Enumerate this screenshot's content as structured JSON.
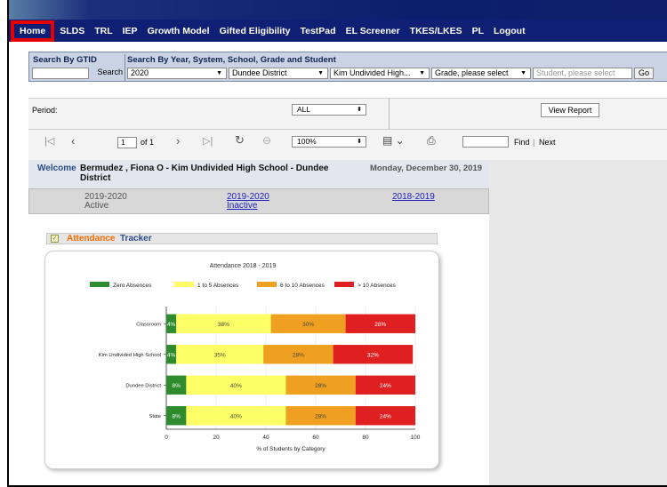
{
  "nav": {
    "items": [
      "Home",
      "SLDS",
      "TRL",
      "IEP",
      "Growth Model",
      "Gifted Eligibility",
      "TestPad",
      "EL Screener",
      "TKES/LKES",
      "PL",
      "Logout"
    ]
  },
  "search": {
    "gtid_label": "Search By GTID",
    "gtid_value": "",
    "search_button": "Search",
    "year_label": "Search By Year, System, School, Grade and Student",
    "year": "2020",
    "system": "Dundee District",
    "school": "Kim Undivided High...",
    "grade": "Grade, please select",
    "student_placeholder": "Student, please select",
    "go_button": "Go"
  },
  "params": {
    "period_label": "Period:",
    "period_value": "ALL",
    "view_report": "View Report"
  },
  "report_toolbar": {
    "page_value": "1",
    "of_pages": "of 1",
    "zoom": "100%",
    "find_label": "Find",
    "separator": "|",
    "next_label": "Next"
  },
  "welcome": {
    "label": "Welcome",
    "name": "Bermudez , Fiona O - Kim Undivided High School - Dundee District",
    "date": "Monday, December 30, 2019"
  },
  "years": {
    "active_year": "2019-2020",
    "active_label": "Active",
    "inactive_year": "2019-2020",
    "inactive_label": "Inactive",
    "other_year": "2018-2019"
  },
  "tracker": {
    "title_part1": "Attendance",
    "title_part2": "Tracker"
  },
  "colors": {
    "zero": "#2e8b2e",
    "one_to_five": "#ffff66",
    "six_to_ten": "#f0a020",
    "over_ten": "#e02020",
    "nav_bg": "#0f1f73",
    "highlight": "#e60000"
  },
  "chart_data": {
    "type": "bar",
    "orientation": "horizontal",
    "stacked": true,
    "title": "Attendance 2018 - 2019",
    "xlabel": "% of Students by Category",
    "ylabel": "",
    "xlim": [
      0,
      100
    ],
    "xticks": [
      "0",
      "20",
      "40",
      "60",
      "80",
      "100"
    ],
    "categories": [
      "Classroom",
      "Kim Undivided High School",
      "Dundee District",
      "State"
    ],
    "legend_position": "top",
    "series": [
      {
        "name": "Zero Absences",
        "values": [
          4,
          4,
          8,
          8
        ],
        "labels": [
          "4%",
          "4%",
          "8%",
          "8%"
        ]
      },
      {
        "name": "1 to 5 Absences",
        "values": [
          38,
          35,
          40,
          40
        ],
        "labels": [
          "38%",
          "35%",
          "40%",
          "40%"
        ]
      },
      {
        "name": "6 to 10 Absences",
        "values": [
          30,
          28,
          28,
          28
        ],
        "labels": [
          "30%",
          "28%",
          "28%",
          "28%"
        ]
      },
      {
        "name": "> 10 Absences",
        "values": [
          28,
          32,
          24,
          24
        ],
        "labels": [
          "28%",
          "32%",
          "24%",
          "24%"
        ]
      }
    ]
  }
}
